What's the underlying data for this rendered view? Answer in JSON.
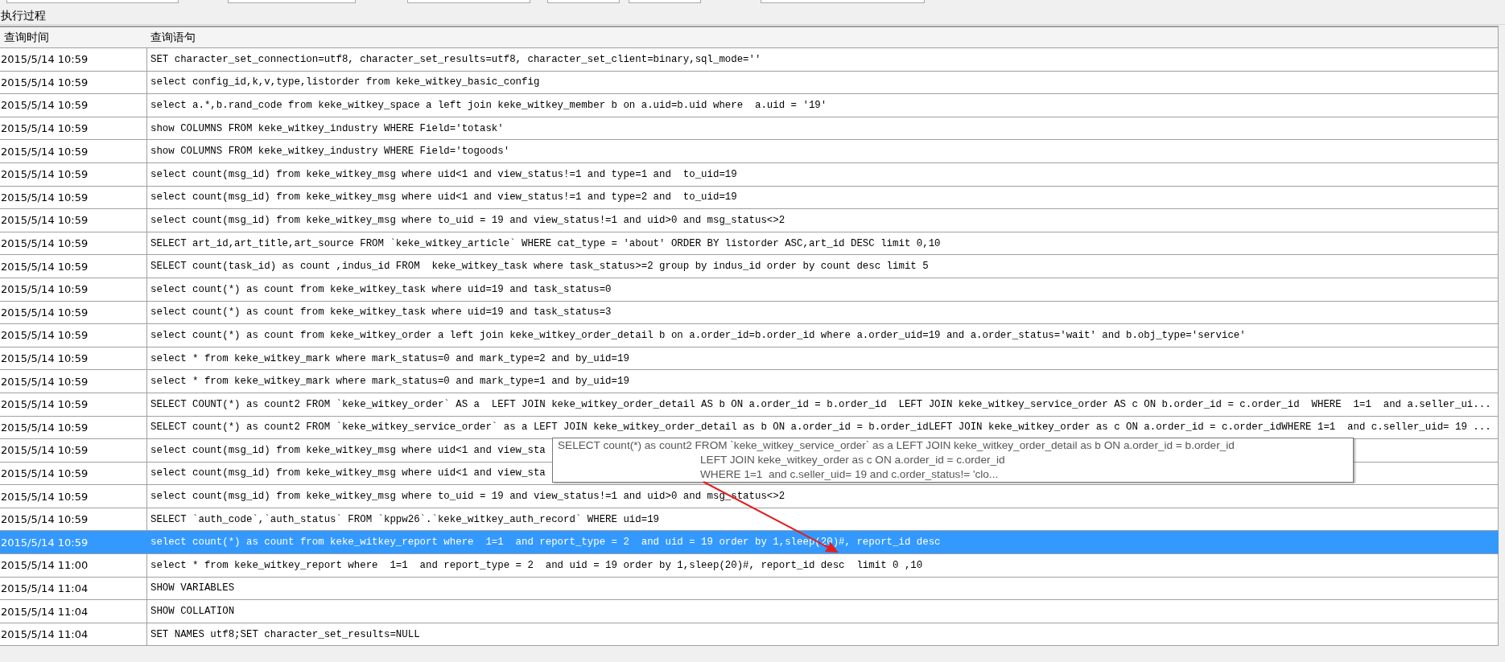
{
  "section_title": "执行过程",
  "columns": [
    "查询时间",
    "查询语句"
  ],
  "rows": [
    {
      "time": "2015/5/14 10:59",
      "query": "SET character_set_connection=utf8, character_set_results=utf8, character_set_client=binary,sql_mode=''",
      "selected": false
    },
    {
      "time": "2015/5/14 10:59",
      "query": "select config_id,k,v,type,listorder from keke_witkey_basic_config",
      "selected": false
    },
    {
      "time": "2015/5/14 10:59",
      "query": "select a.*,b.rand_code from keke_witkey_space a left join keke_witkey_member b on a.uid=b.uid where  a.uid = '19'",
      "selected": false
    },
    {
      "time": "2015/5/14 10:59",
      "query": "show COLUMNS FROM keke_witkey_industry WHERE Field='totask'",
      "selected": false
    },
    {
      "time": "2015/5/14 10:59",
      "query": "show COLUMNS FROM keke_witkey_industry WHERE Field='togoods'",
      "selected": false
    },
    {
      "time": "2015/5/14 10:59",
      "query": "select count(msg_id) from keke_witkey_msg where uid<1 and view_status!=1 and type=1 and  to_uid=19",
      "selected": false
    },
    {
      "time": "2015/5/14 10:59",
      "query": "select count(msg_id) from keke_witkey_msg where uid<1 and view_status!=1 and type=2 and  to_uid=19",
      "selected": false
    },
    {
      "time": "2015/5/14 10:59",
      "query": "select count(msg_id) from keke_witkey_msg where to_uid = 19 and view_status!=1 and uid>0 and msg_status<>2",
      "selected": false
    },
    {
      "time": "2015/5/14 10:59",
      "query": "SELECT art_id,art_title,art_source FROM `keke_witkey_article` WHERE cat_type = 'about' ORDER BY listorder ASC,art_id DESC limit 0,10",
      "selected": false
    },
    {
      "time": "2015/5/14 10:59",
      "query": "SELECT count(task_id) as count ,indus_id FROM  keke_witkey_task where task_status>=2 group by indus_id order by count desc limit 5",
      "selected": false
    },
    {
      "time": "2015/5/14 10:59",
      "query": "select count(*) as count from keke_witkey_task where uid=19 and task_status=0",
      "selected": false
    },
    {
      "time": "2015/5/14 10:59",
      "query": "select count(*) as count from keke_witkey_task where uid=19 and task_status=3",
      "selected": false
    },
    {
      "time": "2015/5/14 10:59",
      "query": "select count(*) as count from keke_witkey_order a left join keke_witkey_order_detail b on a.order_id=b.order_id where a.order_uid=19 and a.order_status='wait' and b.obj_type='service'",
      "selected": false
    },
    {
      "time": "2015/5/14 10:59",
      "query": "select * from keke_witkey_mark where mark_status=0 and mark_type=2 and by_uid=19",
      "selected": false
    },
    {
      "time": "2015/5/14 10:59",
      "query": "select * from keke_witkey_mark where mark_status=0 and mark_type=1 and by_uid=19",
      "selected": false
    },
    {
      "time": "2015/5/14 10:59",
      "query": "SELECT COUNT(*) as count2 FROM `keke_witkey_order` AS a  LEFT JOIN keke_witkey_order_detail AS b ON a.order_id = b.order_id  LEFT JOIN keke_witkey_service_order AS c ON b.order_id = c.order_id  WHERE  1=1  and a.seller_ui...",
      "selected": false
    },
    {
      "time": "2015/5/14 10:59",
      "query": "SELECT count(*) as count2 FROM `keke_witkey_service_order` as a LEFT JOIN keke_witkey_order_detail as b ON a.order_id = b.order_idLEFT JOIN keke_witkey_order as c ON a.order_id = c.order_idWHERE 1=1  and c.seller_uid= 19 ...",
      "selected": false
    },
    {
      "time": "2015/5/14 10:59",
      "query": "select count(msg_id) from keke_witkey_msg where uid<1 and view_sta",
      "selected": false
    },
    {
      "time": "2015/5/14 10:59",
      "query": "select count(msg_id) from keke_witkey_msg where uid<1 and view_sta",
      "selected": false
    },
    {
      "time": "2015/5/14 10:59",
      "query": "select count(msg_id) from keke_witkey_msg where to_uid = 19 and view_status!=1 and uid>0 and msg_status<>2",
      "selected": false
    },
    {
      "time": "2015/5/14 10:59",
      "query": "SELECT `auth_code`,`auth_status` FROM `kppw26`.`keke_witkey_auth_record` WHERE uid=19",
      "selected": false
    },
    {
      "time": "2015/5/14 10:59",
      "query": "select count(*) as count from keke_witkey_report where  1=1  and report_type = 2  and uid = 19 order by 1,sleep(20)#, report_id desc",
      "selected": true
    },
    {
      "time": "2015/5/14 11:00",
      "query": "select * from keke_witkey_report where  1=1  and report_type = 2  and uid = 19 order by 1,sleep(20)#, report_id desc  limit 0 ,10",
      "selected": false
    },
    {
      "time": "2015/5/14 11:04",
      "query": "SHOW VARIABLES",
      "selected": false
    },
    {
      "time": "2015/5/14 11:04",
      "query": "SHOW COLLATION",
      "selected": false
    },
    {
      "time": "2015/5/14 11:04",
      "query": "SET NAMES utf8;SET character_set_results=NULL",
      "selected": false
    }
  ],
  "tooltip": {
    "lines": [
      "SELECT count(*) as count2 FROM `keke_witkey_service_order` as a LEFT JOIN keke_witkey_order_detail as b ON a.order_id = b.order_id",
      "LEFT JOIN keke_witkey_order as c ON a.order_id = c.order_id",
      "WHERE 1=1  and c.seller_uid= 19 and c.order_status!= 'clo..."
    ]
  }
}
